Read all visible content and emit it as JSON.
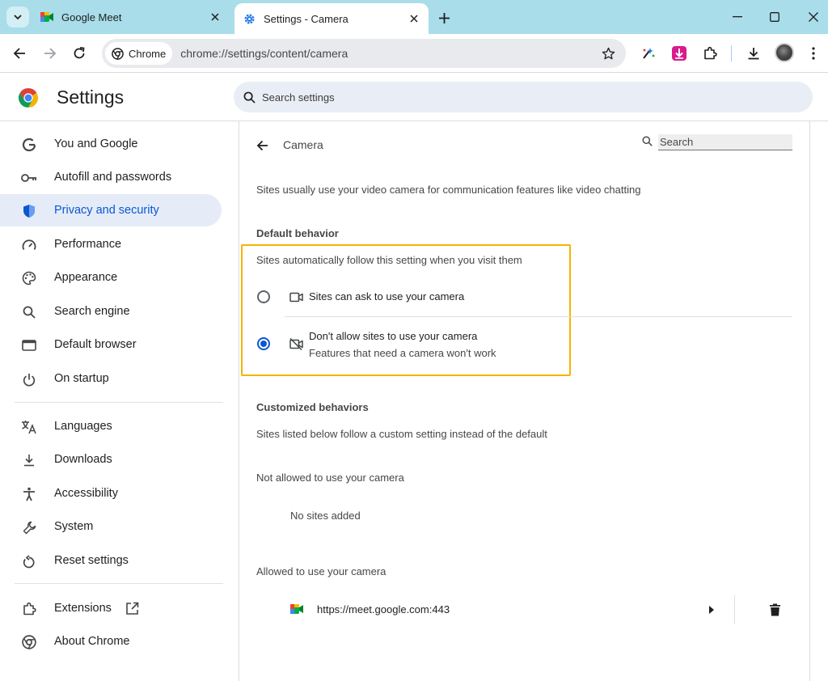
{
  "tabs": [
    {
      "title": "Google Meet",
      "active": false
    },
    {
      "title": "Settings - Camera",
      "active": true
    }
  ],
  "omnibox": {
    "chip_label": "Chrome",
    "url": "chrome://settings/content/camera"
  },
  "settings": {
    "title": "Settings",
    "search_placeholder": "Search settings"
  },
  "sidebar": {
    "items": [
      {
        "label": "You and Google",
        "icon": "google-g-icon"
      },
      {
        "label": "Autofill and passwords",
        "icon": "key-icon"
      },
      {
        "label": "Privacy and security",
        "icon": "shield-icon",
        "selected": true
      },
      {
        "label": "Performance",
        "icon": "speedometer-icon"
      },
      {
        "label": "Appearance",
        "icon": "palette-icon"
      },
      {
        "label": "Search engine",
        "icon": "search-icon"
      },
      {
        "label": "Default browser",
        "icon": "browser-window-icon"
      },
      {
        "label": "On startup",
        "icon": "power-icon"
      },
      {
        "label": "Languages",
        "icon": "translate-icon"
      },
      {
        "label": "Downloads",
        "icon": "download-icon"
      },
      {
        "label": "Accessibility",
        "icon": "accessibility-icon"
      },
      {
        "label": "System",
        "icon": "wrench-icon"
      },
      {
        "label": "Reset settings",
        "icon": "reset-icon"
      },
      {
        "label": "Extensions",
        "icon": "puzzle-icon"
      },
      {
        "label": "About Chrome",
        "icon": "chrome-icon"
      }
    ]
  },
  "camera": {
    "page_title": "Camera",
    "search_placeholder": "Search",
    "description": "Sites usually use your video camera for communication features like video chatting",
    "default_behavior_heading": "Default behavior",
    "default_behavior_sub": "Sites automatically follow this setting when you visit them",
    "option_ask": "Sites can ask to use your camera",
    "option_block": "Don't allow sites to use your camera",
    "option_block_sub": "Features that need a camera won't work",
    "selected_option": "block",
    "customized_heading": "Customized behaviors",
    "customized_sub": "Sites listed below follow a custom setting instead of the default",
    "not_allowed_heading": "Not allowed to use your camera",
    "no_sites": "No sites added",
    "allowed_heading": "Allowed to use your camera",
    "allowed_sites": [
      {
        "url": "https://meet.google.com:443"
      }
    ]
  },
  "colors": {
    "tabstrip": "#a8dde9",
    "accent": "#0b57d0",
    "highlight_border": "#f4b400",
    "selected_nav_bg": "#e5ecf8"
  }
}
